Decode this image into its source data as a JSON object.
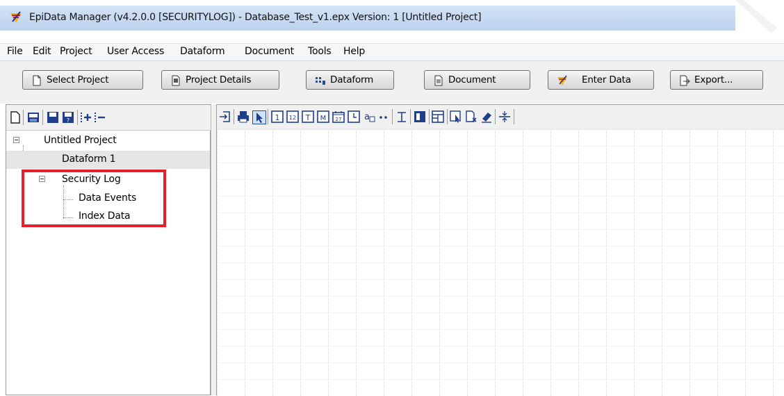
{
  "window": {
    "title": "EpiData Manager (v4.2.0.0 [SECURITYLOG]) - Database_Test_v1.epx Version: 1 [Untitled Project]"
  },
  "menu": [
    "File",
    "Edit",
    "Project",
    "User Access",
    "Dataform",
    "Document",
    "Tools",
    "Help"
  ],
  "toolbar": {
    "select_project": "Select Project",
    "project_details": "Project Details",
    "dataform": "Dataform",
    "document": "Document",
    "enter_data": "Enter Data",
    "export": "Export..."
  },
  "tree": {
    "root": "Untitled Project",
    "dataform": "Dataform 1",
    "security_log": "Security Log",
    "data_events": "Data Events",
    "index_data": "Index Data"
  },
  "colors": {
    "highlight": "#e8202a",
    "title_bar": "#c6d9f1",
    "selected_row": "#e5e5e5"
  }
}
